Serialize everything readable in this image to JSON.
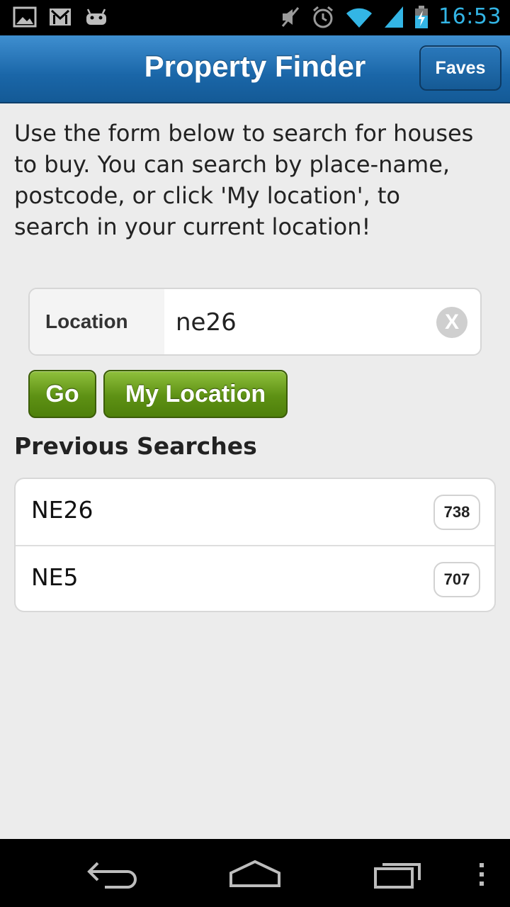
{
  "status_bar": {
    "time": "16:53",
    "icons": [
      "image-icon",
      "gmail-icon",
      "android-icon",
      "mute-icon",
      "alarm-icon",
      "wifi-icon",
      "signal-icon",
      "battery-charging-icon"
    ],
    "accent_color": "#33b5e5"
  },
  "header": {
    "title": "Property Finder",
    "faves_label": "Faves",
    "color": "#1a66a8"
  },
  "intro_text": "Use the form below to search for houses to buy. You can search by place-name, postcode, or click 'My location', to search in your current location!",
  "search": {
    "label": "Location",
    "value": "ne26",
    "clear_label": "X"
  },
  "buttons": {
    "go_label": "Go",
    "my_location_label": "My Location",
    "color": "#5e9114"
  },
  "previous_searches": {
    "title": "Previous Searches",
    "items": [
      {
        "label": "NE26",
        "count": "738"
      },
      {
        "label": "NE5",
        "count": "707"
      }
    ]
  },
  "nav_bar": {
    "icons": [
      "back-icon",
      "home-icon",
      "recent-apps-icon",
      "overflow-menu-icon"
    ]
  }
}
